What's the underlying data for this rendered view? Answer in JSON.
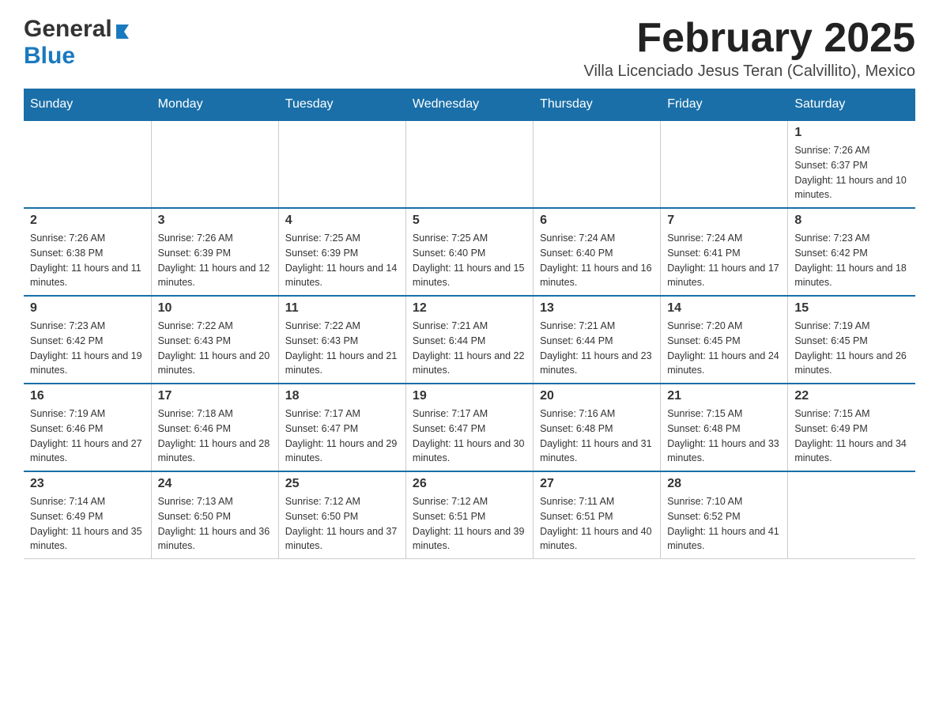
{
  "header": {
    "logo_general": "General",
    "logo_blue": "Blue",
    "title": "February 2025",
    "subtitle": "Villa Licenciado Jesus Teran (Calvillito), Mexico"
  },
  "calendar": {
    "days_of_week": [
      "Sunday",
      "Monday",
      "Tuesday",
      "Wednesday",
      "Thursday",
      "Friday",
      "Saturday"
    ],
    "weeks": [
      [
        {
          "day": "",
          "info": ""
        },
        {
          "day": "",
          "info": ""
        },
        {
          "day": "",
          "info": ""
        },
        {
          "day": "",
          "info": ""
        },
        {
          "day": "",
          "info": ""
        },
        {
          "day": "",
          "info": ""
        },
        {
          "day": "1",
          "info": "Sunrise: 7:26 AM\nSunset: 6:37 PM\nDaylight: 11 hours and 10 minutes."
        }
      ],
      [
        {
          "day": "2",
          "info": "Sunrise: 7:26 AM\nSunset: 6:38 PM\nDaylight: 11 hours and 11 minutes."
        },
        {
          "day": "3",
          "info": "Sunrise: 7:26 AM\nSunset: 6:39 PM\nDaylight: 11 hours and 12 minutes."
        },
        {
          "day": "4",
          "info": "Sunrise: 7:25 AM\nSunset: 6:39 PM\nDaylight: 11 hours and 14 minutes."
        },
        {
          "day": "5",
          "info": "Sunrise: 7:25 AM\nSunset: 6:40 PM\nDaylight: 11 hours and 15 minutes."
        },
        {
          "day": "6",
          "info": "Sunrise: 7:24 AM\nSunset: 6:40 PM\nDaylight: 11 hours and 16 minutes."
        },
        {
          "day": "7",
          "info": "Sunrise: 7:24 AM\nSunset: 6:41 PM\nDaylight: 11 hours and 17 minutes."
        },
        {
          "day": "8",
          "info": "Sunrise: 7:23 AM\nSunset: 6:42 PM\nDaylight: 11 hours and 18 minutes."
        }
      ],
      [
        {
          "day": "9",
          "info": "Sunrise: 7:23 AM\nSunset: 6:42 PM\nDaylight: 11 hours and 19 minutes."
        },
        {
          "day": "10",
          "info": "Sunrise: 7:22 AM\nSunset: 6:43 PM\nDaylight: 11 hours and 20 minutes."
        },
        {
          "day": "11",
          "info": "Sunrise: 7:22 AM\nSunset: 6:43 PM\nDaylight: 11 hours and 21 minutes."
        },
        {
          "day": "12",
          "info": "Sunrise: 7:21 AM\nSunset: 6:44 PM\nDaylight: 11 hours and 22 minutes."
        },
        {
          "day": "13",
          "info": "Sunrise: 7:21 AM\nSunset: 6:44 PM\nDaylight: 11 hours and 23 minutes."
        },
        {
          "day": "14",
          "info": "Sunrise: 7:20 AM\nSunset: 6:45 PM\nDaylight: 11 hours and 24 minutes."
        },
        {
          "day": "15",
          "info": "Sunrise: 7:19 AM\nSunset: 6:45 PM\nDaylight: 11 hours and 26 minutes."
        }
      ],
      [
        {
          "day": "16",
          "info": "Sunrise: 7:19 AM\nSunset: 6:46 PM\nDaylight: 11 hours and 27 minutes."
        },
        {
          "day": "17",
          "info": "Sunrise: 7:18 AM\nSunset: 6:46 PM\nDaylight: 11 hours and 28 minutes."
        },
        {
          "day": "18",
          "info": "Sunrise: 7:17 AM\nSunset: 6:47 PM\nDaylight: 11 hours and 29 minutes."
        },
        {
          "day": "19",
          "info": "Sunrise: 7:17 AM\nSunset: 6:47 PM\nDaylight: 11 hours and 30 minutes."
        },
        {
          "day": "20",
          "info": "Sunrise: 7:16 AM\nSunset: 6:48 PM\nDaylight: 11 hours and 31 minutes."
        },
        {
          "day": "21",
          "info": "Sunrise: 7:15 AM\nSunset: 6:48 PM\nDaylight: 11 hours and 33 minutes."
        },
        {
          "day": "22",
          "info": "Sunrise: 7:15 AM\nSunset: 6:49 PM\nDaylight: 11 hours and 34 minutes."
        }
      ],
      [
        {
          "day": "23",
          "info": "Sunrise: 7:14 AM\nSunset: 6:49 PM\nDaylight: 11 hours and 35 minutes."
        },
        {
          "day": "24",
          "info": "Sunrise: 7:13 AM\nSunset: 6:50 PM\nDaylight: 11 hours and 36 minutes."
        },
        {
          "day": "25",
          "info": "Sunrise: 7:12 AM\nSunset: 6:50 PM\nDaylight: 11 hours and 37 minutes."
        },
        {
          "day": "26",
          "info": "Sunrise: 7:12 AM\nSunset: 6:51 PM\nDaylight: 11 hours and 39 minutes."
        },
        {
          "day": "27",
          "info": "Sunrise: 7:11 AM\nSunset: 6:51 PM\nDaylight: 11 hours and 40 minutes."
        },
        {
          "day": "28",
          "info": "Sunrise: 7:10 AM\nSunset: 6:52 PM\nDaylight: 11 hours and 41 minutes."
        },
        {
          "day": "",
          "info": ""
        }
      ]
    ]
  }
}
